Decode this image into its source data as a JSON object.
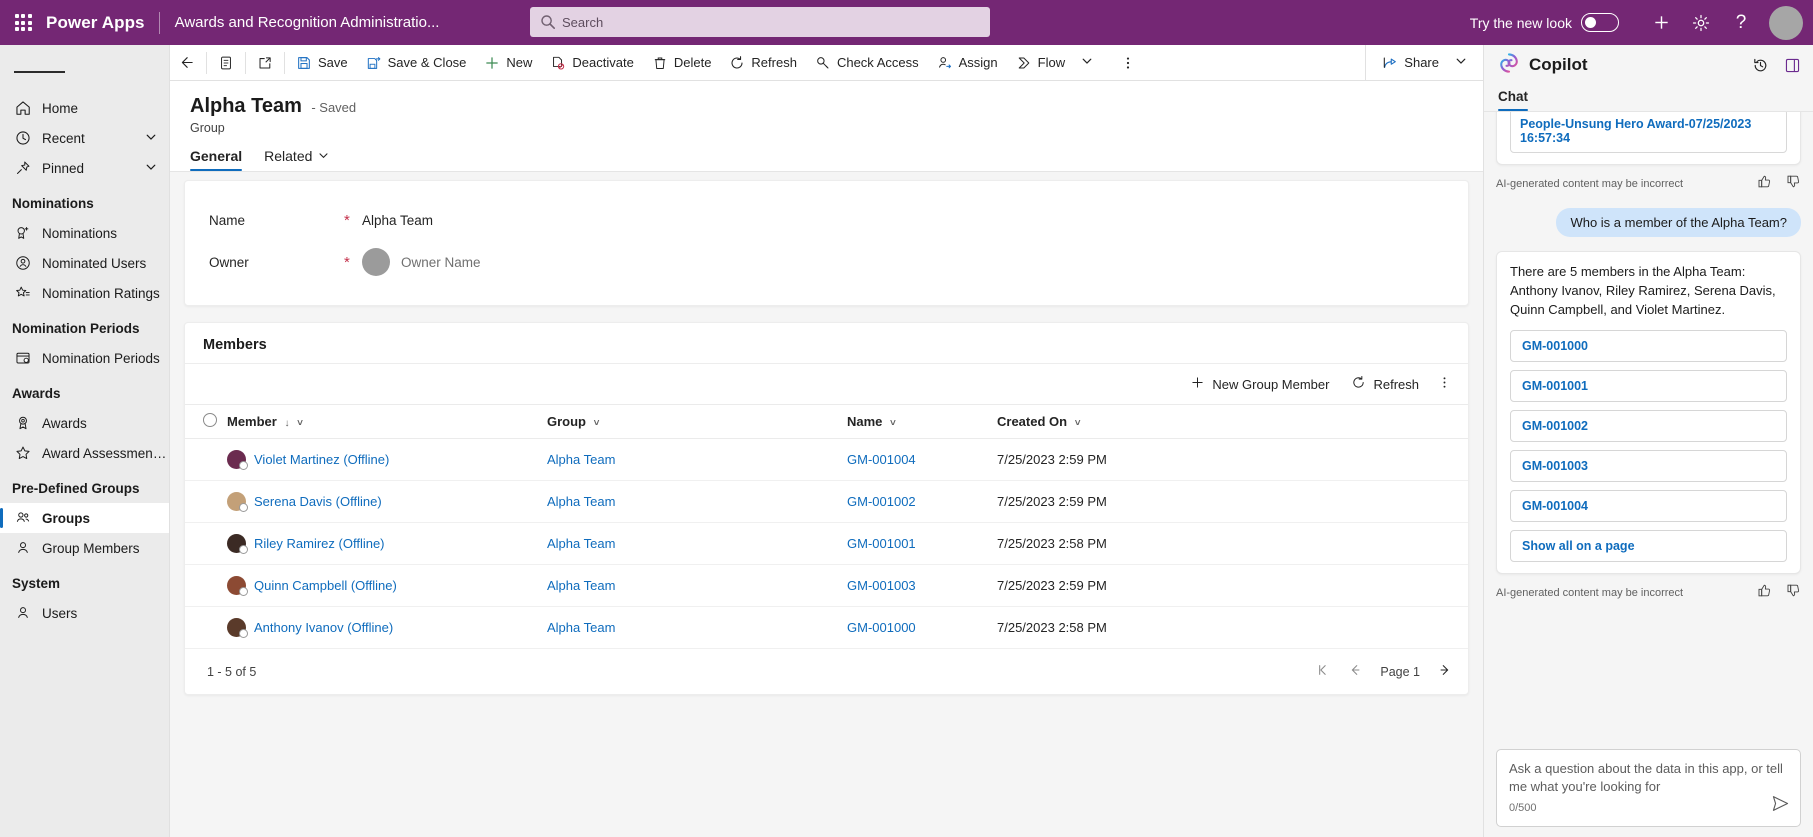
{
  "topbar": {
    "waffle_label": "app-launcher",
    "brand": "Power Apps",
    "app_name": "Awards and Recognition Administratio...",
    "search_placeholder": "Search",
    "search_value": "",
    "new_look_label": "Try the new look",
    "toggle_state": "off",
    "plus_label": "+",
    "gear_label": "settings",
    "help_label": "?"
  },
  "sidebar": {
    "hamburger_label": "Site map",
    "items": [
      {
        "label": "Home",
        "icon": "home-icon",
        "chevron": false,
        "active": false
      },
      {
        "label": "Recent",
        "icon": "clock-icon",
        "chevron": true,
        "active": false
      },
      {
        "label": "Pinned",
        "icon": "pin-icon",
        "chevron": true,
        "active": false
      }
    ],
    "groups": [
      {
        "title": "Nominations",
        "items": [
          {
            "label": "Nominations",
            "icon": "ribbon-plus-icon",
            "active": false
          },
          {
            "label": "Nominated Users",
            "icon": "user-badge-icon",
            "active": false
          },
          {
            "label": "Nomination Ratings",
            "icon": "star-list-icon",
            "active": false
          }
        ]
      },
      {
        "title": "Nomination Periods",
        "items": [
          {
            "label": "Nomination Periods",
            "icon": "calendar-clock-icon",
            "active": false
          }
        ]
      },
      {
        "title": "Awards",
        "items": [
          {
            "label": "Awards",
            "icon": "medal-icon",
            "active": false
          },
          {
            "label": "Award Assessment R...",
            "icon": "star-icon",
            "active": false
          }
        ]
      },
      {
        "title": "Pre-Defined Groups",
        "items": [
          {
            "label": "Groups",
            "icon": "people-icon",
            "active": true
          },
          {
            "label": "Group Members",
            "icon": "person-icon",
            "active": false
          }
        ]
      },
      {
        "title": "System",
        "items": [
          {
            "label": "Users",
            "icon": "person-icon",
            "active": false
          }
        ]
      }
    ]
  },
  "commandbar": {
    "back_label": "Back",
    "form_selector_label": "Form selector",
    "popout_label": "Open in new window",
    "commands": [
      {
        "label": "Save",
        "icon": "save-icon"
      },
      {
        "label": "Save & Close",
        "icon": "save-close-icon"
      },
      {
        "label": "New",
        "icon": "plus-icon"
      },
      {
        "label": "Deactivate",
        "icon": "deactivate-icon"
      },
      {
        "label": "Delete",
        "icon": "trash-icon"
      },
      {
        "label": "Refresh",
        "icon": "refresh-icon"
      },
      {
        "label": "Check Access",
        "icon": "key-icon"
      },
      {
        "label": "Assign",
        "icon": "assign-icon"
      },
      {
        "label": "Flow",
        "icon": "flow-icon",
        "chevron": true
      }
    ],
    "overflow_label": "More commands",
    "share_label": "Share",
    "share_icon": "share-icon"
  },
  "record": {
    "title": "Alpha Team",
    "saved_status": "- Saved",
    "entity": "Group",
    "tabs": [
      {
        "label": "General",
        "active": true,
        "chevron": false
      },
      {
        "label": "Related",
        "active": false,
        "chevron": true
      }
    ]
  },
  "form": {
    "fields": [
      {
        "label": "Name",
        "required": true,
        "value": "Alpha Team",
        "placeholder": false
      },
      {
        "label": "Owner",
        "required": true,
        "value": "Owner Name",
        "placeholder": true,
        "avatar": true
      }
    ]
  },
  "subgrid": {
    "title": "Members",
    "commands": [
      {
        "label": "New Group Member",
        "icon": "plus-icon"
      },
      {
        "label": "Refresh",
        "icon": "refresh-icon"
      }
    ],
    "overflow_label": "More grid commands",
    "select_all_label": "Select all rows",
    "columns": [
      {
        "label": "Member",
        "sorted": true,
        "sort_dir": "down"
      },
      {
        "label": "Group",
        "sorted": false
      },
      {
        "label": "Name",
        "sorted": false
      },
      {
        "label": "Created On",
        "sorted": false
      }
    ],
    "rows": [
      {
        "member": "Violet Martinez (Offline)",
        "avatar_color": "#6b2b4f",
        "group": "Alpha Team",
        "name": "GM-001004",
        "created_on": "7/25/2023 2:59 PM"
      },
      {
        "member": "Serena Davis (Offline)",
        "avatar_color": "#c3a078",
        "group": "Alpha Team",
        "name": "GM-001002",
        "created_on": "7/25/2023 2:59 PM"
      },
      {
        "member": "Riley Ramirez (Offline)",
        "avatar_color": "#3b2a24",
        "group": "Alpha Team",
        "name": "GM-001001",
        "created_on": "7/25/2023 2:58 PM"
      },
      {
        "member": "Quinn Campbell (Offline)",
        "avatar_color": "#8c4a33",
        "group": "Alpha Team",
        "name": "GM-001003",
        "created_on": "7/25/2023 2:59 PM"
      },
      {
        "member": "Anthony Ivanov (Offline)",
        "avatar_color": "#5a3a2a",
        "group": "Alpha Team",
        "name": "GM-001000",
        "created_on": "7/25/2023 2:58 PM"
      }
    ],
    "footer_count": "1 - 5 of 5",
    "page_label": "Page 1",
    "first_page_label": "First page",
    "prev_page_label": "Previous page",
    "next_page_label": "Next page"
  },
  "copilot": {
    "title": "Copilot",
    "logo_icon": "copilot-icon",
    "history_icon": "history-icon",
    "expand_icon": "expand-icon",
    "tabs": [
      {
        "label": "Chat",
        "active": true
      }
    ],
    "messages": [
      {
        "role": "assistant",
        "citation": "People-Unsung Hero Award-07/25/2023 16:57:34",
        "disclaimer": "AI-generated content may be incorrect"
      },
      {
        "role": "user",
        "text": "Who is a member of the Alpha Team?"
      },
      {
        "role": "assistant",
        "text": "There are 5 members in the Alpha Team: Anthony Ivanov, Riley Ramirez, Serena Davis, Quinn Campbell, and Violet Martinez.",
        "references": [
          "GM-001000",
          "GM-001001",
          "GM-001002",
          "GM-001003",
          "GM-001004"
        ],
        "show_all_label": "Show all on a page",
        "disclaimer": "AI-generated content may be incorrect"
      }
    ],
    "thumbs_up_icon": "thumbs-up-icon",
    "thumbs_down_icon": "thumbs-down-icon",
    "input_placeholder": "Ask a question about the data in this app, or tell me what you're looking for",
    "char_count": "0/500",
    "send_icon": "send-icon"
  },
  "colors": {
    "brand_purple": "#742774",
    "accent_blue": "#0f6cbd",
    "required_red": "#c4314b",
    "sidebar_bg": "#ebebeb",
    "user_bubble": "#cfe4fa"
  }
}
